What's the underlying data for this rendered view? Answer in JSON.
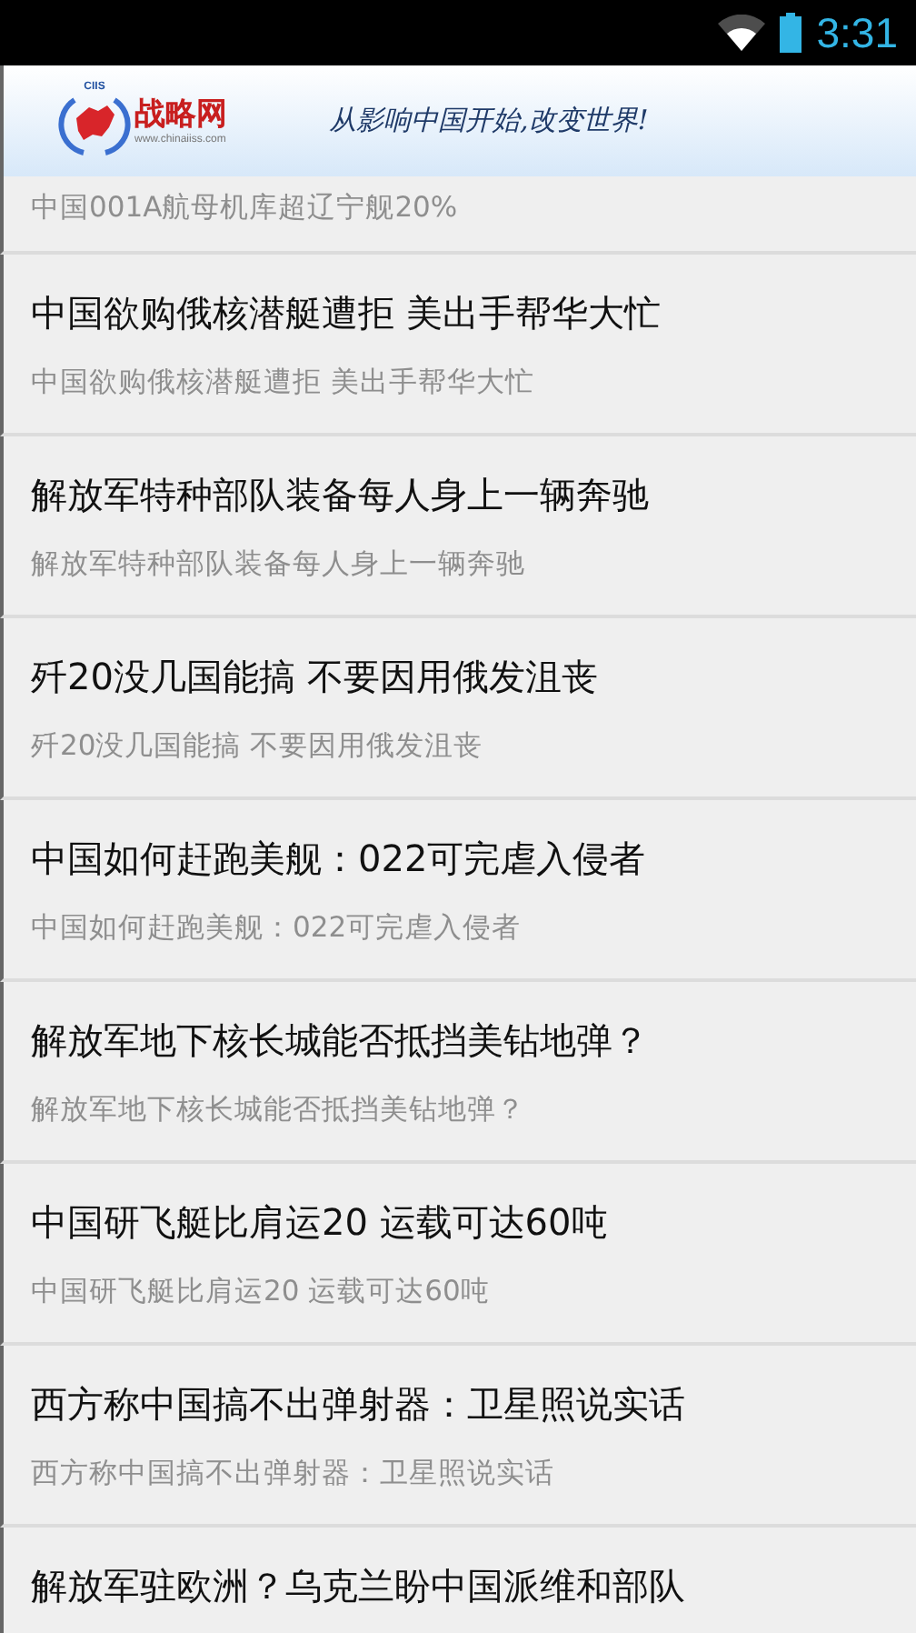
{
  "status_bar": {
    "time": "3:31"
  },
  "header": {
    "logo_acronym": "CIIS",
    "logo_name": "战略网",
    "logo_url": "www.chinaiiss.com",
    "slogan": "从影响中国开始,改变世界!"
  },
  "articles": [
    {
      "summary": "中国001A航母机库超辽宁舰20%"
    },
    {
      "title": "中国欲购俄核潜艇遭拒 美出手帮华大忙",
      "summary": "中国欲购俄核潜艇遭拒 美出手帮华大忙"
    },
    {
      "title": "解放军特种部队装备每人身上一辆奔驰",
      "summary": "解放军特种部队装备每人身上一辆奔驰"
    },
    {
      "title": "歼20没几国能搞 不要因用俄发沮丧",
      "summary": "歼20没几国能搞 不要因用俄发沮丧"
    },
    {
      "title": "中国如何赶跑美舰：022可完虐入侵者",
      "summary": "中国如何赶跑美舰：022可完虐入侵者"
    },
    {
      "title": "解放军地下核长城能否抵挡美钻地弹？",
      "summary": "解放军地下核长城能否抵挡美钻地弹？"
    },
    {
      "title": "中国研飞艇比肩运20 运载可达60吨",
      "summary": "中国研飞艇比肩运20 运载可达60吨"
    },
    {
      "title": "西方称中国搞不出弹射器：卫星照说实话",
      "summary": "西方称中国搞不出弹射器：卫星照说实话"
    },
    {
      "title": "解放军驻欧洲？乌克兰盼中国派维和部队"
    }
  ]
}
